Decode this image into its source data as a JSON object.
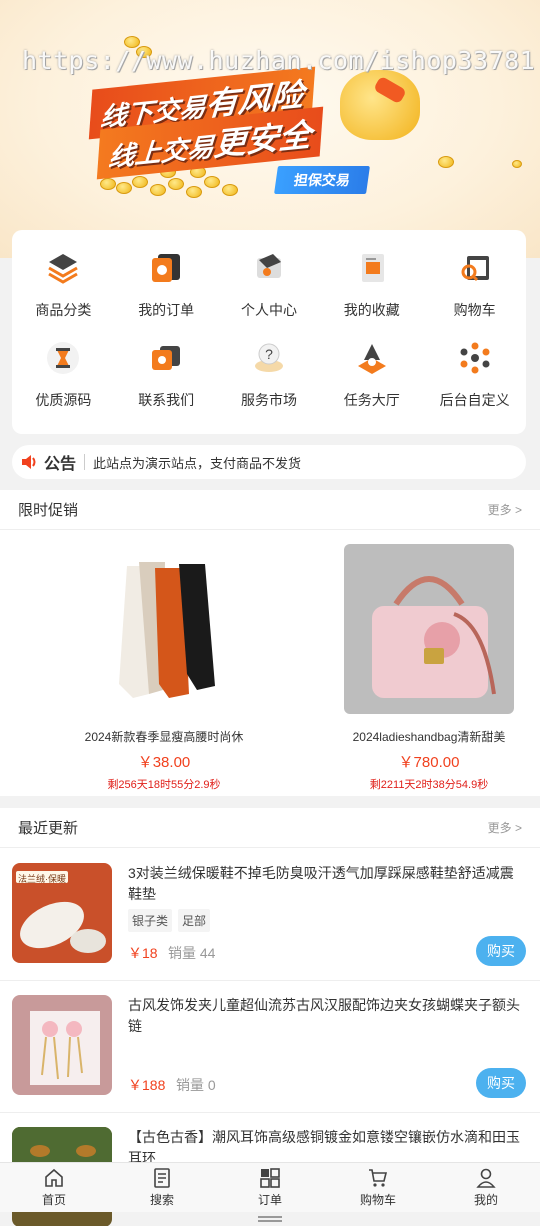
{
  "banner": {
    "watermark": "https://www.huzhan.com/ishop33781",
    "slogan_line1_a": "线下交易",
    "slogan_line1_b": "有风险",
    "slogan_line2_a": "线上交易",
    "slogan_line2_b": "更安全",
    "guarantee_label": "担保交易"
  },
  "grid": {
    "items": [
      {
        "label": "商品分类",
        "icon": "layers-icon"
      },
      {
        "label": "我的订单",
        "icon": "order-icon"
      },
      {
        "label": "个人中心",
        "icon": "user-center-icon"
      },
      {
        "label": "我的收藏",
        "icon": "favorite-icon"
      },
      {
        "label": "购物车",
        "icon": "cart-icon"
      },
      {
        "label": "优质源码",
        "icon": "source-code-icon"
      },
      {
        "label": "联系我们",
        "icon": "contact-icon"
      },
      {
        "label": "服务市场",
        "icon": "service-market-icon"
      },
      {
        "label": "任务大厅",
        "icon": "task-hall-icon"
      },
      {
        "label": "后台自定义",
        "icon": "custom-admin-icon"
      }
    ]
  },
  "notice": {
    "title": "公告",
    "text": "此站点为演示站点，支付商品不发货"
  },
  "promo": {
    "title": "限时促销",
    "more": "更多 >",
    "items": [
      {
        "name": "2024新款春季显瘦高腰时尚休",
        "price": "￥38.00",
        "timer": "剩256天18时55分2.9秒"
      },
      {
        "name": "2024ladieshandbag清新甜美",
        "price": "￥780.00",
        "timer": "剩2211天2时38分54.9秒"
      }
    ]
  },
  "recent": {
    "title": "最近更新",
    "more": "更多 >",
    "items": [
      {
        "title": "3对装兰绒保暖鞋不掉毛防臭吸汗透气加厚踩屎感鞋垫舒适减震鞋垫",
        "tags": [
          "银子类",
          "足部"
        ],
        "price": "￥18",
        "sales": "销量 44",
        "buy": "购买"
      },
      {
        "title": "古风发饰发夹儿童超仙流苏古风汉服配饰边夹女孩蝴蝶夹子额头链",
        "tags": [],
        "price": "￥188",
        "sales": "销量 0",
        "buy": "购买"
      },
      {
        "title": "【古色古香】潮风耳饰高级感铜镀金如意镂空镶嵌仿水滴和田玉耳环",
        "tags": [],
        "price": "",
        "sales": "",
        "buy": ""
      }
    ],
    "img1_text": "法兰绒·保暖"
  },
  "tabbar": {
    "items": [
      {
        "label": "首页",
        "icon": "home-icon"
      },
      {
        "label": "搜索",
        "icon": "search-doc-icon"
      },
      {
        "label": "订单",
        "icon": "grid-order-icon"
      },
      {
        "label": "购物车",
        "icon": "cart-icon"
      },
      {
        "label": "我的",
        "icon": "profile-icon"
      }
    ]
  }
}
